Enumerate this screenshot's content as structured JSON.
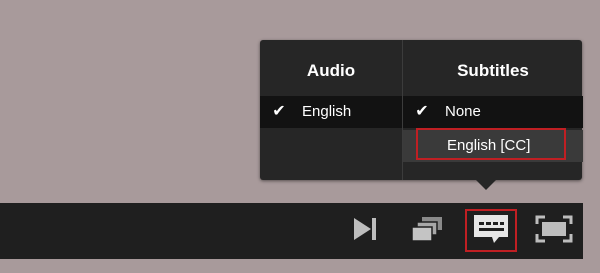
{
  "menu": {
    "audio": {
      "title": "Audio",
      "selected": "English"
    },
    "subtitles": {
      "title": "Subtitles",
      "selected": "None",
      "option": "English [CC]"
    }
  },
  "controls": {
    "icons": [
      "next-icon",
      "playlist-icon",
      "captions-icon",
      "fullscreen-icon"
    ]
  },
  "colors": {
    "background": "#a89a9b",
    "menu": "#262626",
    "controlbar": "#1f1f1f",
    "highlight": "#c01f23"
  }
}
